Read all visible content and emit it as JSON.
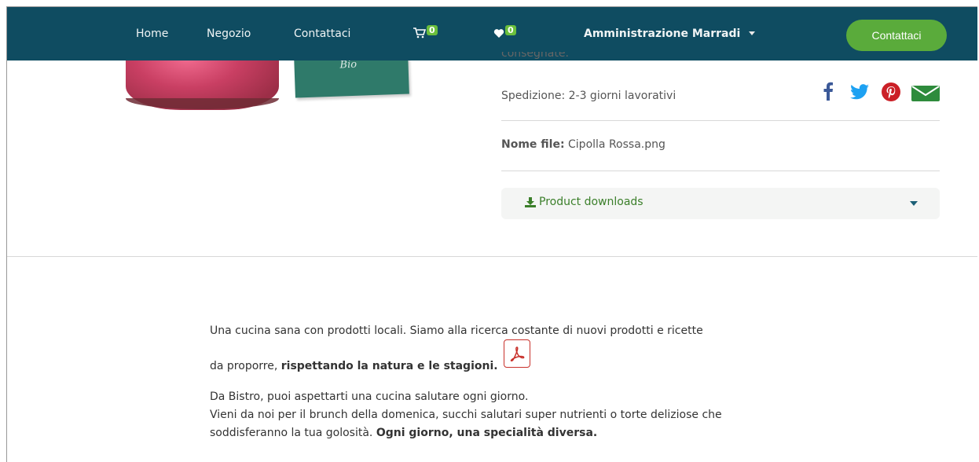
{
  "nav": {
    "home": "Home",
    "shop": "Negozio",
    "contact": "Contattaci",
    "cart_count": "0",
    "wishlist_count": "0",
    "admin": "Amministrazione Marradi",
    "cta": "Contattaci"
  },
  "product": {
    "tag_text": "Bio",
    "cut_text": "consegnate.",
    "shipping": "Spedizione: 2-3 giorni lavorativi",
    "file_label": "Nome file:",
    "file_name": " Cipolla Rossa.png",
    "downloads_label": "Product downloads"
  },
  "description": {
    "line1": "Una cucina sana con prodotti locali. Siamo alla ricerca costante di nuovi prodotti e ricette",
    "line2_normal": "da proporre, ",
    "line2_bold": "rispettando la natura e le stagioni.",
    "line3": "Da Bistro, puoi aspettarti una cucina salutare ogni giorno.",
    "line4": "Vieni da noi per il brunch della domenica, succhi salutari super nutrienti o torte deliziose che",
    "line5_normal": "soddisferanno la tua golosità. ",
    "line5_bold": "Ogni giorno, una specialità diversa."
  },
  "colors": {
    "navbar": "#0f4c61",
    "cta": "#5aab3b",
    "facebook": "#3b5998",
    "twitter": "#1da1f2",
    "pinterest": "#cb2027",
    "email": "#2e8b3c",
    "pdf": "#c8312b"
  }
}
